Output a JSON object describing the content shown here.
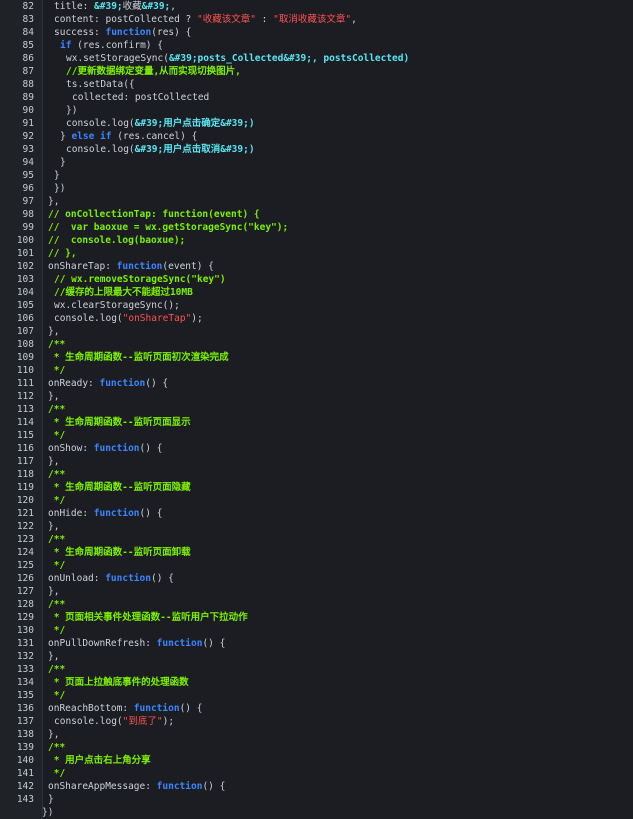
{
  "lines": [
    {
      "n": "82",
      "indent": 1,
      "tokens": [
        [
          "t-plain",
          "title: "
        ],
        [
          "t-cyan",
          "&#39;"
        ],
        [
          "t-plain",
          "收藏"
        ],
        [
          "t-cyan",
          "&#39;"
        ],
        [
          "t-plain",
          ","
        ]
      ]
    },
    {
      "n": "83",
      "indent": 1,
      "tokens": [
        [
          "t-plain",
          "content: postCollected ? "
        ],
        [
          "t-str",
          "\"收藏该文章\""
        ],
        [
          "t-plain",
          " : "
        ],
        [
          "t-str",
          "\"取消收藏该文章\""
        ],
        [
          "t-plain",
          ","
        ]
      ]
    },
    {
      "n": "84",
      "indent": 1,
      "tokens": [
        [
          "t-plain",
          "success: "
        ],
        [
          "t-kw",
          "function"
        ],
        [
          "t-plain",
          "(res) {"
        ]
      ]
    },
    {
      "n": "85",
      "indent": 2,
      "tokens": [
        [
          "t-kw",
          "if"
        ],
        [
          "t-plain",
          " (res.confirm) {"
        ]
      ]
    },
    {
      "n": "86",
      "indent": 3,
      "tokens": [
        [
          "t-plain",
          "wx.setStorageSync("
        ],
        [
          "t-cyan",
          "&#39;posts_Collected&#39;, postsCollected)"
        ]
      ]
    },
    {
      "n": "87",
      "indent": 3,
      "tokens": [
        [
          "t-green",
          "//更新数据绑定变量,从而实现切换图片,"
        ]
      ]
    },
    {
      "n": "88",
      "indent": 3,
      "tokens": [
        [
          "t-plain",
          "ts.setData({"
        ]
      ]
    },
    {
      "n": "89",
      "indent": 4,
      "tokens": [
        [
          "t-plain",
          "collected: postCollected"
        ]
      ]
    },
    {
      "n": "90",
      "indent": 3,
      "tokens": [
        [
          "t-plain",
          "})"
        ]
      ]
    },
    {
      "n": "91",
      "indent": 3,
      "tokens": [
        [
          "t-plain",
          "console.log("
        ],
        [
          "t-cyan",
          "&#39;用户点击确定&#39;)"
        ]
      ]
    },
    {
      "n": "92",
      "indent": 2,
      "tokens": [
        [
          "t-plain",
          "} "
        ],
        [
          "t-kw",
          "else if"
        ],
        [
          "t-plain",
          " (res.cancel) {"
        ]
      ]
    },
    {
      "n": "93",
      "indent": 3,
      "tokens": [
        [
          "t-plain",
          "console.log("
        ],
        [
          "t-cyan",
          "&#39;用户点击取消&#39;)"
        ]
      ]
    },
    {
      "n": "94",
      "indent": 2,
      "tokens": [
        [
          "t-plain",
          "}"
        ]
      ]
    },
    {
      "n": "95",
      "indent": 1,
      "tokens": [
        [
          "t-plain",
          "}"
        ]
      ]
    },
    {
      "n": "96",
      "indent": 1,
      "tokens": [
        [
          "t-plain",
          "})"
        ]
      ]
    },
    {
      "n": "97",
      "indent": 0,
      "tokens": [
        [
          "t-plain",
          "},"
        ]
      ]
    },
    {
      "n": "98",
      "indent": 0,
      "tokens": [
        [
          "t-green",
          "// onCollectionTap: function(event) {"
        ]
      ]
    },
    {
      "n": "99",
      "indent": 0,
      "tokens": [
        [
          "t-green",
          "//  var baoxue = wx.getStorageSync(\"key\");"
        ]
      ]
    },
    {
      "n": "100",
      "indent": 0,
      "tokens": [
        [
          "t-green",
          "//  console.log(baoxue);"
        ]
      ]
    },
    {
      "n": "101",
      "indent": 0,
      "tokens": [
        [
          "t-green",
          "// },"
        ]
      ]
    },
    {
      "n": "102",
      "indent": 0,
      "tokens": [
        [
          "t-plain",
          "onShareTap: "
        ],
        [
          "t-kw",
          "function"
        ],
        [
          "t-plain",
          "(event) {"
        ]
      ]
    },
    {
      "n": "103",
      "indent": 1,
      "tokens": [
        [
          "t-green",
          "// wx.removeStorageSync(\"key\")"
        ]
      ]
    },
    {
      "n": "104",
      "indent": 1,
      "tokens": [
        [
          "t-green",
          "//缓存的上限最大不能超过10MB"
        ]
      ]
    },
    {
      "n": "105",
      "indent": 1,
      "tokens": [
        [
          "t-plain",
          "wx.clearStorageSync();"
        ]
      ]
    },
    {
      "n": "106",
      "indent": 1,
      "tokens": [
        [
          "t-plain",
          "console.log("
        ],
        [
          "t-str",
          "\"onShareTap\""
        ],
        [
          "t-plain",
          ");"
        ]
      ]
    },
    {
      "n": "107",
      "indent": 0,
      "tokens": [
        [
          "t-plain",
          "},"
        ]
      ]
    },
    {
      "n": "108",
      "indent": 0,
      "tokens": [
        [
          "t-green",
          "/**"
        ]
      ]
    },
    {
      "n": "109",
      "indent": 0,
      "tokens": [
        [
          "t-green",
          " * 生命周期函数--监听页面初次渲染完成"
        ]
      ]
    },
    {
      "n": "110",
      "indent": 0,
      "tokens": [
        [
          "t-green",
          " */"
        ]
      ]
    },
    {
      "n": "111",
      "indent": 0,
      "tokens": [
        [
          "t-plain",
          "onReady: "
        ],
        [
          "t-kw",
          "function"
        ],
        [
          "t-plain",
          "() {"
        ]
      ]
    },
    {
      "n": "112",
      "indent": 0,
      "tokens": [
        [
          "t-plain",
          "},"
        ]
      ]
    },
    {
      "n": "113",
      "indent": 0,
      "tokens": [
        [
          "t-green",
          "/**"
        ]
      ]
    },
    {
      "n": "114",
      "indent": 0,
      "tokens": [
        [
          "t-green",
          " * 生命周期函数--监听页面显示"
        ]
      ]
    },
    {
      "n": "115",
      "indent": 0,
      "tokens": [
        [
          "t-green",
          " */"
        ]
      ]
    },
    {
      "n": "116",
      "indent": 0,
      "tokens": [
        [
          "t-plain",
          "onShow: "
        ],
        [
          "t-kw",
          "function"
        ],
        [
          "t-plain",
          "() {"
        ]
      ]
    },
    {
      "n": "117",
      "indent": 0,
      "tokens": [
        [
          "t-plain",
          "},"
        ]
      ]
    },
    {
      "n": "118",
      "indent": 0,
      "tokens": [
        [
          "t-green",
          "/**"
        ]
      ]
    },
    {
      "n": "119",
      "indent": 0,
      "tokens": [
        [
          "t-green",
          " * 生命周期函数--监听页面隐藏"
        ]
      ]
    },
    {
      "n": "120",
      "indent": 0,
      "tokens": [
        [
          "t-green",
          " */"
        ]
      ]
    },
    {
      "n": "121",
      "indent": 0,
      "tokens": [
        [
          "t-plain",
          "onHide: "
        ],
        [
          "t-kw",
          "function"
        ],
        [
          "t-plain",
          "() {"
        ]
      ]
    },
    {
      "n": "122",
      "indent": 0,
      "tokens": [
        [
          "t-plain",
          "},"
        ]
      ]
    },
    {
      "n": "123",
      "indent": 0,
      "tokens": [
        [
          "t-green",
          "/**"
        ]
      ]
    },
    {
      "n": "124",
      "indent": 0,
      "tokens": [
        [
          "t-green",
          " * 生命周期函数--监听页面卸载"
        ]
      ]
    },
    {
      "n": "125",
      "indent": 0,
      "tokens": [
        [
          "t-green",
          " */"
        ]
      ]
    },
    {
      "n": "126",
      "indent": 0,
      "tokens": [
        [
          "t-plain",
          "onUnload: "
        ],
        [
          "t-kw",
          "function"
        ],
        [
          "t-plain",
          "() {"
        ]
      ]
    },
    {
      "n": "127",
      "indent": 0,
      "tokens": [
        [
          "t-plain",
          "},"
        ]
      ]
    },
    {
      "n": "128",
      "indent": 0,
      "tokens": [
        [
          "t-green",
          "/**"
        ]
      ]
    },
    {
      "n": "129",
      "indent": 0,
      "tokens": [
        [
          "t-green",
          " * 页面相关事件处理函数--监听用户下拉动作"
        ]
      ]
    },
    {
      "n": "130",
      "indent": 0,
      "tokens": [
        [
          "t-green",
          " */"
        ]
      ]
    },
    {
      "n": "131",
      "indent": 0,
      "tokens": [
        [
          "t-plain",
          "onPullDownRefresh: "
        ],
        [
          "t-kw",
          "function"
        ],
        [
          "t-plain",
          "() {"
        ]
      ]
    },
    {
      "n": "132",
      "indent": 0,
      "tokens": [
        [
          "t-plain",
          "},"
        ]
      ]
    },
    {
      "n": "133",
      "indent": 0,
      "tokens": [
        [
          "t-green",
          "/**"
        ]
      ]
    },
    {
      "n": "134",
      "indent": 0,
      "tokens": [
        [
          "t-green",
          " * 页面上拉触底事件的处理函数"
        ]
      ]
    },
    {
      "n": "135",
      "indent": 0,
      "tokens": [
        [
          "t-green",
          " */"
        ]
      ]
    },
    {
      "n": "136",
      "indent": 0,
      "tokens": [
        [
          "t-plain",
          "onReachBottom: "
        ],
        [
          "t-kw",
          "function"
        ],
        [
          "t-plain",
          "() {"
        ]
      ]
    },
    {
      "n": "137",
      "indent": 1,
      "tokens": [
        [
          "t-plain",
          "console.log("
        ],
        [
          "t-str",
          "\"到底了\""
        ],
        [
          "t-plain",
          ");"
        ]
      ]
    },
    {
      "n": "138",
      "indent": 0,
      "tokens": [
        [
          "t-plain",
          "},"
        ]
      ]
    },
    {
      "n": "139",
      "indent": 0,
      "tokens": [
        [
          "t-green",
          "/**"
        ]
      ]
    },
    {
      "n": "140",
      "indent": 0,
      "tokens": [
        [
          "t-green",
          " * 用户点击右上角分享"
        ]
      ]
    },
    {
      "n": "141",
      "indent": 0,
      "tokens": [
        [
          "t-green",
          " */"
        ]
      ]
    },
    {
      "n": "142",
      "indent": 0,
      "tokens": [
        [
          "t-plain",
          "onShareAppMessage: "
        ],
        [
          "t-kw",
          "function"
        ],
        [
          "t-plain",
          "() {"
        ]
      ]
    },
    {
      "n": "143",
      "indent": 0,
      "tokens": [
        [
          "t-plain",
          "}"
        ]
      ]
    },
    {
      "n": "",
      "indent": -1,
      "tokens": [
        [
          "t-plain",
          "})"
        ]
      ]
    }
  ]
}
